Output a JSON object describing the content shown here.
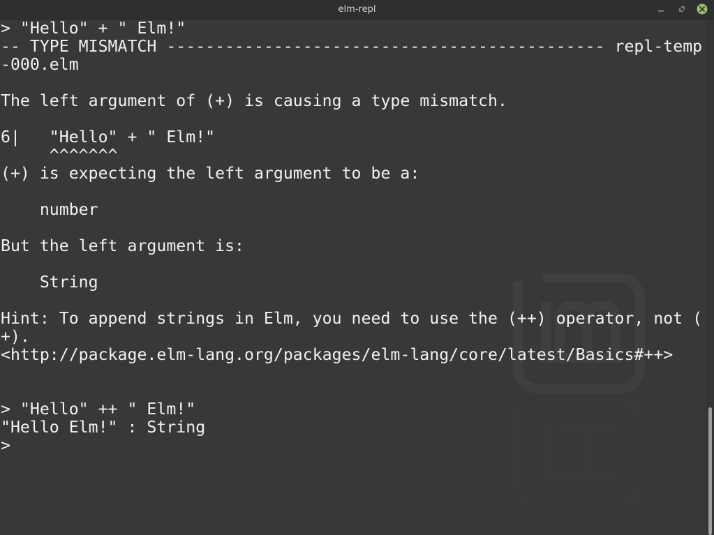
{
  "window": {
    "title": "elm-repl",
    "minimize_icon": "minimize-icon",
    "maximize_icon": "maximize-icon",
    "close_icon": "close-icon",
    "close_color": "#9bbf6c"
  },
  "terminal": {
    "lines": [
      "> \"Hello\" + \" Elm!\"",
      "-- TYPE MISMATCH --------------------------------------------- repl-temp",
      "-000.elm",
      "",
      "The left argument of (+) is causing a type mismatch.",
      "",
      "6|   \"Hello\" + \" Elm!\"",
      "     ^^^^^^^",
      "(+) is expecting the left argument to be a:",
      "",
      "    number",
      "",
      "But the left argument is:",
      "",
      "    String",
      "",
      "Hint: To append strings in Elm, you need to use the (++) operator, not (",
      "+).",
      "<http://package.elm-lang.org/packages/elm-lang/core/latest/Basics#++>",
      "",
      "",
      "> \"Hello\" ++ \" Elm!\"",
      "\"Hello Elm!\" : String",
      ">"
    ]
  },
  "watermark_icon": "linux-mint-logo-icon",
  "colors": {
    "background": "#383838",
    "text": "#f1f1f1",
    "titlebar": "#2f2f2f"
  }
}
